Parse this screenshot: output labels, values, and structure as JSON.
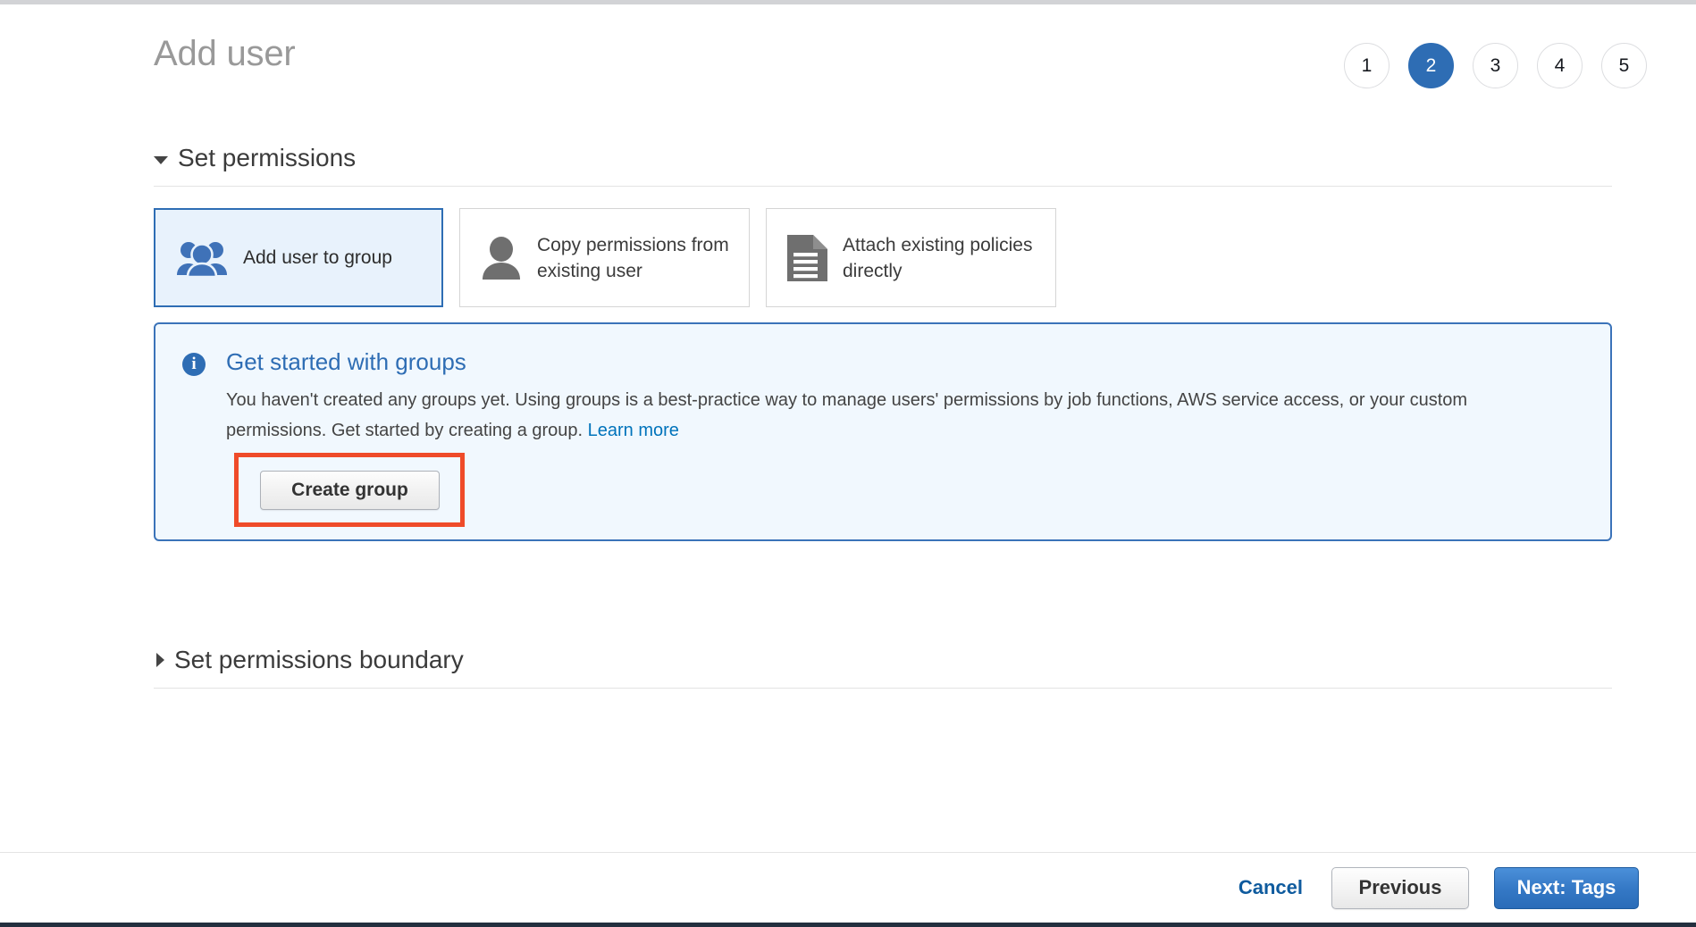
{
  "page": {
    "title": "Add user"
  },
  "steps": {
    "items": [
      "1",
      "2",
      "3",
      "4",
      "5"
    ],
    "active_index": 1,
    "active_color": "#2e6db4"
  },
  "permissions_section": {
    "title": "Set permissions",
    "expanded": true,
    "caret_icon": "caret-down-icon",
    "options": [
      {
        "label": "Add user to group",
        "icon": "user-group-icon",
        "selected": true,
        "icon_color": "#3f72b8"
      },
      {
        "label": "Copy permissions from existing user",
        "icon": "user-icon",
        "selected": false,
        "icon_color": "#6f6f6f"
      },
      {
        "label": "Attach existing policies directly",
        "icon": "document-icon",
        "selected": false,
        "icon_color": "#6f6f6f"
      }
    ]
  },
  "info_panel": {
    "icon": "info-circle-icon",
    "title": "Get started with groups",
    "body_text": "You haven't created any groups yet. Using groups is a best-practice way to manage users' permissions by job functions, AWS service access, or your custom permissions. Get started by creating a group.",
    "link_label": "Learn more",
    "create_button_label": "Create group",
    "border_color": "#3b73b9",
    "background_color": "#f1f8fe",
    "title_color": "#2e6db4"
  },
  "annotation": {
    "type": "highlight-rectangle",
    "color": "#ef4b29",
    "target": "Create group"
  },
  "boundary_section": {
    "title": "Set permissions boundary",
    "expanded": false,
    "caret_icon": "caret-right-icon"
  },
  "footer": {
    "cancel_label": "Cancel",
    "previous_label": "Previous",
    "next_label": "Next: Tags",
    "cancel_color": "#0f5b9e",
    "next_color": "#3579c6"
  }
}
